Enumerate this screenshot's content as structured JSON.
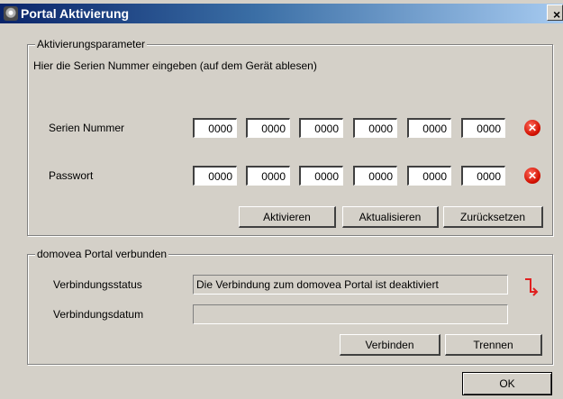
{
  "window": {
    "title": "Portal Aktivierung",
    "close_glyph": "×"
  },
  "activation": {
    "group_title": "Aktivierungsparameter",
    "instruction": "Hier die Serien Nummer eingeben (auf dem Gerät ablesen)",
    "serial": {
      "label": "Serien Nummer",
      "values": [
        "0000",
        "0000",
        "0000",
        "0000",
        "0000",
        "0000"
      ]
    },
    "password": {
      "label": "Passwort",
      "values": [
        "0000",
        "0000",
        "0000",
        "0000",
        "0000",
        "0000"
      ]
    },
    "buttons": {
      "activate": "Aktivieren",
      "refresh": "Aktualisieren",
      "reset": "Zurücksetzen"
    }
  },
  "portal": {
    "group_title": "domovea Portal verbunden",
    "status_label": "Verbindungsstatus",
    "status_value": "Die Verbindung zum domovea Portal ist deaktiviert",
    "date_label": "Verbindungsdatum",
    "date_value": "",
    "buttons": {
      "connect": "Verbinden",
      "disconnect": "Trennen"
    }
  },
  "ok_label": "OK",
  "colors": {
    "error_icon": "#d21000",
    "link_icon": "#e02020",
    "title_gradient_start": "#0a246a",
    "title_gradient_end": "#a6caf0"
  }
}
